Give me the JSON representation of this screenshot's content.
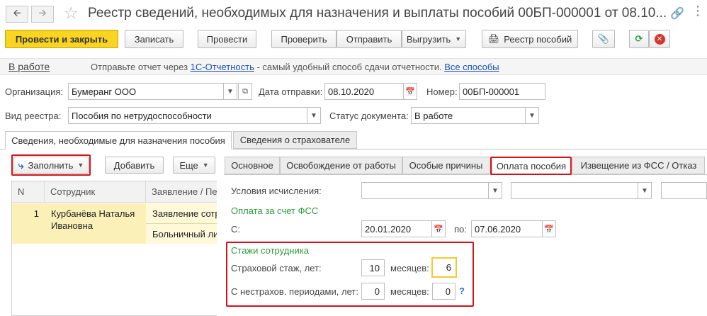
{
  "window": {
    "title": "Реестр сведений, необходимых для назначения и выплаты пособий 00БП-000001 от 08.10..."
  },
  "toolbar": {
    "post_close": "Провести и закрыть",
    "save": "Записать",
    "post": "Провести",
    "check": "Проверить",
    "send": "Отправить",
    "upload": "Выгрузить",
    "registry": "Реестр пособий"
  },
  "info": {
    "status_link": "В работе",
    "text_before": "Отправьте отчет через ",
    "link_1c": "1С-Отчетность",
    "text_after": " - самый удобный способ сдачи отчетности. ",
    "link_all": "Все способы"
  },
  "form": {
    "org_label": "Организация:",
    "org_value": "Бумеранг ООО",
    "send_date_label": "Дата отправки:",
    "send_date_value": "08.10.2020",
    "number_label": "Номер:",
    "number_value": "00БП-000001",
    "registry_type_label": "Вид реестра:",
    "registry_type_value": "Пособия по нетрудоспособности",
    "doc_status_label": "Статус документа:",
    "doc_status_value": "В работе"
  },
  "main_tabs": [
    {
      "label": "Сведения, необходимые для назначения пособия"
    },
    {
      "label": "Сведения о страхователе"
    }
  ],
  "left_panel": {
    "fill": "Заполнить",
    "add": "Добавить",
    "more": "Еще",
    "columns": [
      "N",
      "Сотрудник",
      "Заявление / Пе"
    ],
    "rows": [
      {
        "n": "1",
        "employee_line1": "Курбанёва Наталья",
        "employee_line2": "Ивановна",
        "stmt1": "Заявление сотр",
        "stmt2": "Больничный ли"
      }
    ]
  },
  "sub_tabs": [
    {
      "label": "Основное"
    },
    {
      "label": "Освобождение от работы"
    },
    {
      "label": "Особые причины"
    },
    {
      "label": "Оплата пособия"
    },
    {
      "label": "Извещение из ФСС / Отказ"
    }
  ],
  "payment": {
    "conditions_label": "Условия исчисления:",
    "fss_header": "Оплата за счет ФСС",
    "from_label": "С:",
    "from_value": "20.01.2020",
    "to_label": "по:",
    "to_value": "07.06.2020",
    "stazh_header": "Стажи сотрудника",
    "insured_label": "Страховой стаж, лет:",
    "insured_years": "10",
    "months_label": "месяцев:",
    "insured_months": "6",
    "noninsured_label": "С нестрахов. периодами, лет:",
    "noninsured_years": "0",
    "noninsured_months": "0",
    "help": "?"
  },
  "colors": {
    "primary_button": "#f9d423",
    "highlight_red": "#d0141b",
    "green_header": "#2e9a3a",
    "row_selected": "#fbf0b8"
  }
}
